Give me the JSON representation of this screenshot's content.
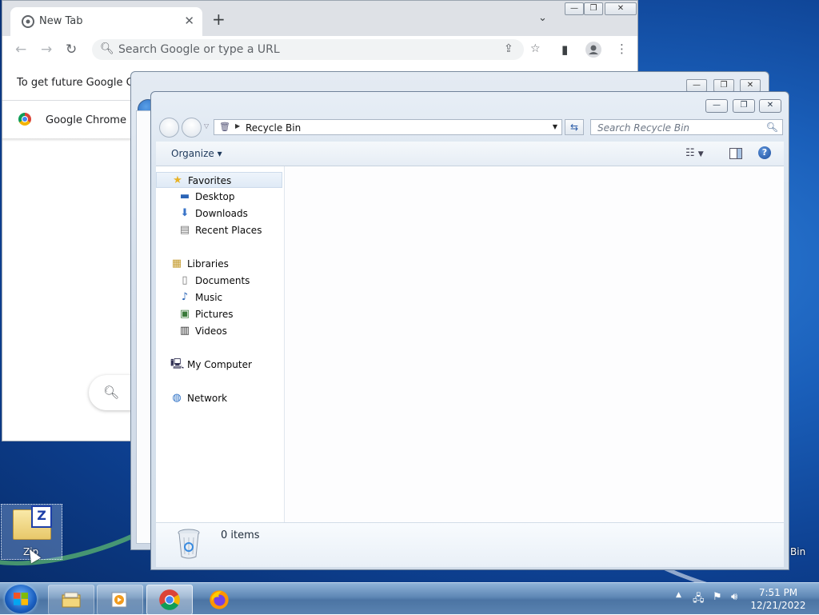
{
  "chrome": {
    "tab_title": "New Tab",
    "tab_close": "✕",
    "new_tab": "+",
    "tab_search": "⌄",
    "omnibox_placeholder": "Search Google or type a URL",
    "info_bar_1": "To get future Google Chr",
    "info_bar_2": "Google Chrome isn",
    "win_minimize": "—",
    "win_restore": "❐",
    "win_close": "✕"
  },
  "explorer": {
    "address": "Recycle Bin",
    "search_placeholder": "Search Recycle Bin",
    "organize_label": "Organize",
    "item_count": "0 items",
    "cap_minimize": "—",
    "cap_restore": "❐",
    "cap_close": "✕",
    "nav": [
      {
        "label": "Favorites",
        "icon": "star-icon",
        "header": true
      },
      {
        "label": "Desktop",
        "icon": "desktop-icon"
      },
      {
        "label": "Downloads",
        "icon": "downloads-icon"
      },
      {
        "label": "Recent Places",
        "icon": "recent-places-icon"
      },
      {
        "label": "Libraries",
        "icon": "libraries-icon",
        "header": true
      },
      {
        "label": "Documents",
        "icon": "documents-icon"
      },
      {
        "label": "Music",
        "icon": "music-icon"
      },
      {
        "label": "Pictures",
        "icon": "pictures-icon"
      },
      {
        "label": "Videos",
        "icon": "videos-icon"
      },
      {
        "label": "My Computer",
        "icon": "computer-icon",
        "header": true
      },
      {
        "label": "Network",
        "icon": "network-icon",
        "header": true
      }
    ]
  },
  "desktop": {
    "zip_label": "Zip",
    "bin_label": "Bin"
  },
  "taskbar": {
    "time": "7:51 PM",
    "date": "12/21/2022"
  }
}
